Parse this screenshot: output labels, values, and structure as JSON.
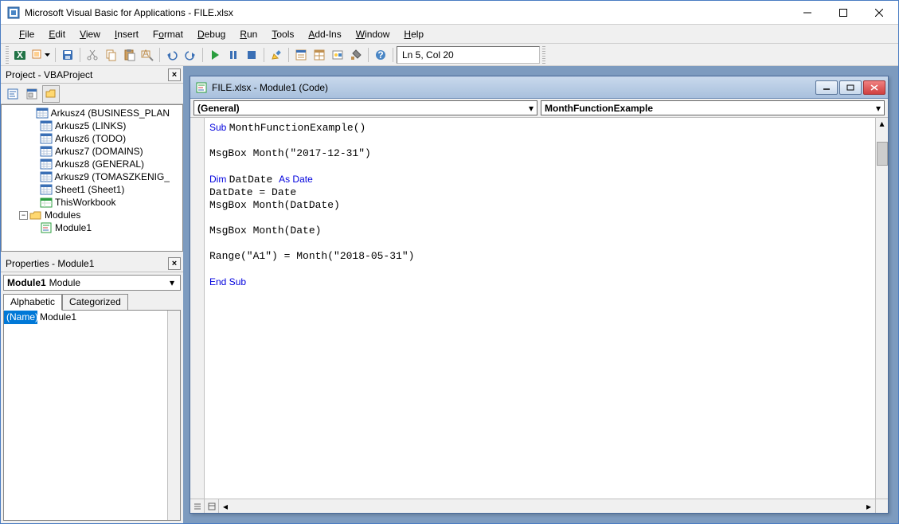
{
  "titlebar": {
    "title": "Microsoft Visual Basic for Applications - FILE.xlsx"
  },
  "menu": [
    "File",
    "Edit",
    "View",
    "Insert",
    "Format",
    "Debug",
    "Run",
    "Tools",
    "Add-Ins",
    "Window",
    "Help"
  ],
  "menu_accel": [
    "F",
    "E",
    "V",
    "I",
    "o",
    "D",
    "R",
    "T",
    "A",
    "W",
    "H"
  ],
  "status": "Ln 5, Col 20",
  "project_panel": {
    "title": "Project - VBAProject",
    "tree": [
      {
        "indent": 48,
        "icon": "sheet",
        "label": "Arkusz4 (BUSINESS_PLAN"
      },
      {
        "indent": 48,
        "icon": "sheet",
        "label": "Arkusz5 (LINKS)"
      },
      {
        "indent": 48,
        "icon": "sheet",
        "label": "Arkusz6 (TODO)"
      },
      {
        "indent": 48,
        "icon": "sheet",
        "label": "Arkusz7 (DOMAINS)"
      },
      {
        "indent": 48,
        "icon": "sheet",
        "label": "Arkusz8 (GENERAL)"
      },
      {
        "indent": 48,
        "icon": "sheet",
        "label": "Arkusz9 (TOMASZKENIG_"
      },
      {
        "indent": 48,
        "icon": "sheet",
        "label": "Sheet1 (Sheet1)"
      },
      {
        "indent": 48,
        "icon": "wb",
        "label": "ThisWorkbook"
      },
      {
        "indent": 22,
        "twisty": "-",
        "icon": "folder",
        "label": "Modules"
      },
      {
        "indent": 48,
        "icon": "module",
        "label": "Module1"
      }
    ]
  },
  "properties_panel": {
    "title": "Properties - Module1",
    "combo_name": "Module1",
    "combo_type": "Module",
    "tabs": [
      "Alphabetic",
      "Categorized"
    ],
    "prop_name": "(Name)",
    "prop_value": "Module1"
  },
  "code_window": {
    "title": "FILE.xlsx - Module1 (Code)",
    "combo_left": "(General)",
    "combo_right": "MonthFunctionExample",
    "code_lines": [
      {
        "t": "kw",
        "s": "Sub "
      },
      {
        "t": "n",
        "s": "MonthFunctionExample()\n\nMsgBox Month(\"2017-12-31\")\n\n"
      },
      {
        "t": "kw",
        "s": "Dim "
      },
      {
        "t": "n",
        "s": "DatDate "
      },
      {
        "t": "kw",
        "s": "As Date"
      },
      {
        "t": "n",
        "s": "\nDatDate = Date\nMsgBox Month(DatDate)\n\nMsgBox Month(Date)\n\nRange(\"A1\") = Month(\"2018-05-31\")\n\n"
      },
      {
        "t": "kw",
        "s": "End Sub"
      }
    ]
  }
}
